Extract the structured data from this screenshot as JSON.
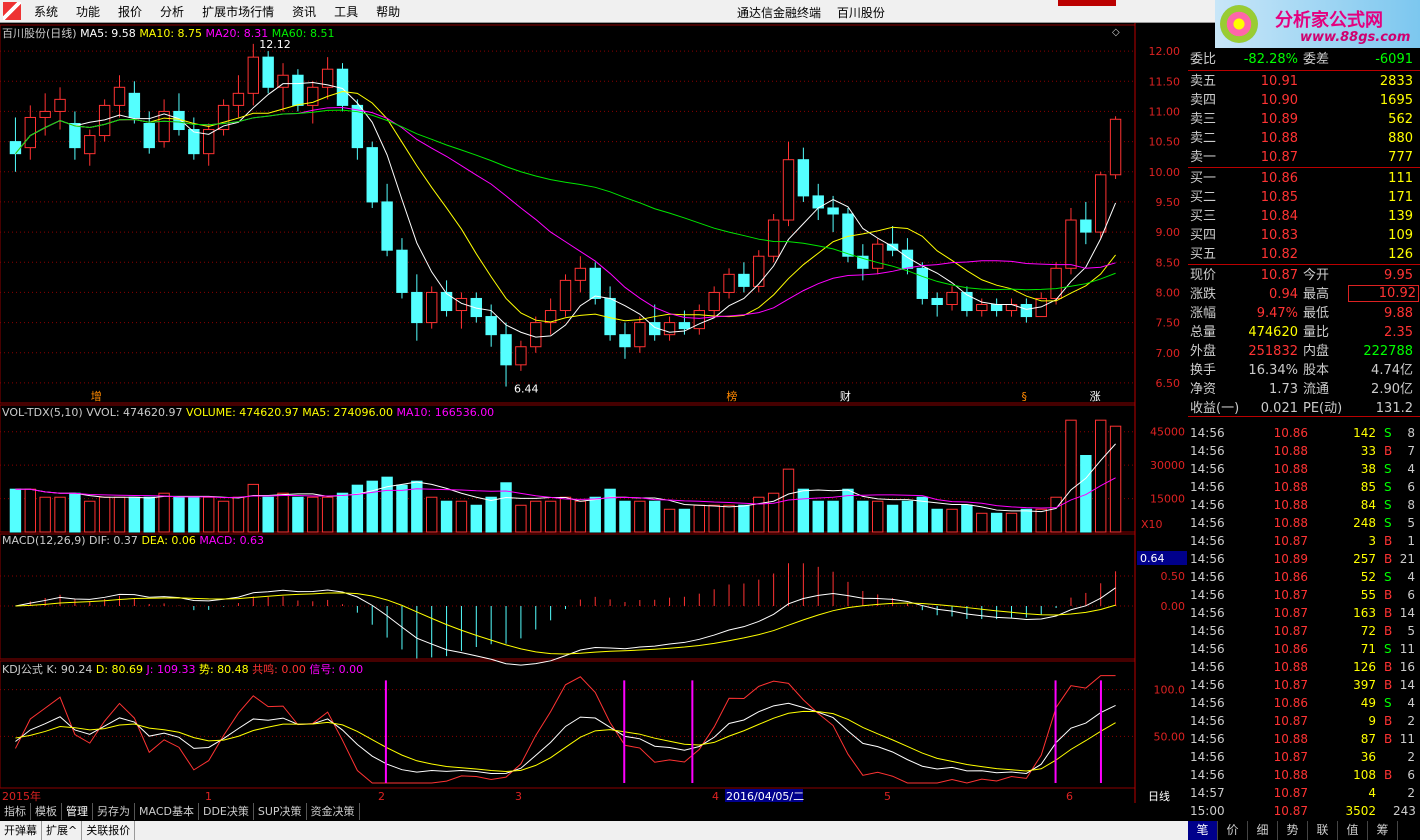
{
  "menu": {
    "items": [
      "系统",
      "功能",
      "报价",
      "分析",
      "扩展市场行情",
      "资讯",
      "工具",
      "帮助"
    ],
    "center_items": [
      "通达信金融终端",
      "百川股份"
    ]
  },
  "brand": {
    "title": "分析家公式网",
    "url": "www.88gs.com"
  },
  "colors": {
    "up": "#ff3232",
    "down": "#54ffff",
    "ma5": "#ffffff",
    "ma10": "#ffff00",
    "ma20": "#ff00ff",
    "ma60": "#00e600",
    "grid": "#8b0000",
    "bg": "#000000"
  },
  "main_chart": {
    "title": "百川股份(日线)",
    "ma5": "MA5: 9.58",
    "ma10": "MA10: 8.75",
    "ma20": "MA20: 8.31",
    "ma60": "MA60: 8.51",
    "high_label": "12.12",
    "low_label": "6.44",
    "markers": [
      "增",
      "榜",
      "财",
      "§",
      "涨"
    ],
    "y_ticks": [
      "12.00",
      "11.50",
      "11.00",
      "10.50",
      "10.00",
      "9.50",
      "9.00",
      "8.50",
      "8.00",
      "7.50",
      "7.00",
      "6.50"
    ]
  },
  "vol_chart": {
    "title": "VOL-TDX(5,10)",
    "vvol": "VVOL: 474620.97",
    "volume": "VOLUME: 474620.97",
    "ma5": "MA5: 274096.00",
    "ma10": "MA10: 166536.00",
    "y_ticks": [
      "45000",
      "30000",
      "15000"
    ],
    "unit": "X10"
  },
  "macd_chart": {
    "title": "MACD(12,26,9)",
    "dif": "DIF: 0.37",
    "dea": "DEA: 0.06",
    "macd": "MACD: 0.63",
    "y_ticks": [
      "0.50",
      "0.00"
    ],
    "current": "0.64"
  },
  "kdj_chart": {
    "title": "KDJ公式",
    "k": "K: 90.24",
    "d": "D: 80.69",
    "j": "J: 109.33",
    "shi": "势: 80.48",
    "gongming": "共鸣: 0.00",
    "xinhao": "信号: 0.00",
    "y_ticks": [
      "100.0",
      "50.00"
    ]
  },
  "xaxis": {
    "labels": [
      "2015年",
      "1",
      "2",
      "3",
      "4",
      "2016/04/05/二",
      "5",
      "6"
    ],
    "period": "日线"
  },
  "bottom_tabs": [
    "指标",
    "模板",
    "管理",
    "另存为",
    "MACD基本",
    "DDE决策",
    "SUP决策",
    "资金决策"
  ],
  "status_items": [
    "开弹幕",
    "扩展^",
    "关联报价"
  ],
  "quote": {
    "weibi_label": "委比",
    "weibi_value": "-82.28%",
    "weicha_label": "委差",
    "weicha_value": "-6091",
    "asks": [
      {
        "label": "卖五",
        "price": "10.91",
        "vol": "2833"
      },
      {
        "label": "卖四",
        "price": "10.90",
        "vol": "1695"
      },
      {
        "label": "卖三",
        "price": "10.89",
        "vol": "562"
      },
      {
        "label": "卖二",
        "price": "10.88",
        "vol": "880"
      },
      {
        "label": "卖一",
        "price": "10.87",
        "vol": "777"
      }
    ],
    "bids": [
      {
        "label": "买一",
        "price": "10.86",
        "vol": "111"
      },
      {
        "label": "买二",
        "price": "10.85",
        "vol": "171"
      },
      {
        "label": "买三",
        "price": "10.84",
        "vol": "139"
      },
      {
        "label": "买四",
        "price": "10.83",
        "vol": "109"
      },
      {
        "label": "买五",
        "price": "10.82",
        "vol": "126"
      }
    ],
    "stats": [
      {
        "l1": "现价",
        "v1": "10.87",
        "l2": "今开",
        "v2": "9.95"
      },
      {
        "l1": "涨跌",
        "v1": "0.94",
        "l2": "最高",
        "v2": "10.92"
      },
      {
        "l1": "涨幅",
        "v1": "9.47%",
        "l2": "最低",
        "v2": "9.88"
      },
      {
        "l1": "总量",
        "v1": "474620",
        "l2": "量比",
        "v2": "2.35"
      },
      {
        "l1": "外盘",
        "v1": "251832",
        "l2": "内盘",
        "v2": "222788"
      },
      {
        "l1": "换手",
        "v1": "16.34%",
        "l2": "股本",
        "v2": "4.74亿"
      },
      {
        "l1": "净资",
        "v1": "1.73",
        "l2": "流通",
        "v2": "2.90亿"
      },
      {
        "l1": "收益(一)",
        "v1": "0.021",
        "l2": "PE(动)",
        "v2": "131.2"
      }
    ],
    "ticks": [
      {
        "t": "14:56",
        "p": "10.86",
        "v": "142",
        "bs": "S",
        "n": "8"
      },
      {
        "t": "14:56",
        "p": "10.88",
        "v": "33",
        "bs": "B",
        "n": "7"
      },
      {
        "t": "14:56",
        "p": "10.88",
        "v": "38",
        "bs": "S",
        "n": "4"
      },
      {
        "t": "14:56",
        "p": "10.88",
        "v": "85",
        "bs": "S",
        "n": "6"
      },
      {
        "t": "14:56",
        "p": "10.88",
        "v": "84",
        "bs": "S",
        "n": "8"
      },
      {
        "t": "14:56",
        "p": "10.88",
        "v": "248",
        "bs": "S",
        "n": "5"
      },
      {
        "t": "14:56",
        "p": "10.87",
        "v": "3",
        "bs": "B",
        "n": "1"
      },
      {
        "t": "14:56",
        "p": "10.89",
        "v": "257",
        "bs": "B",
        "n": "21"
      },
      {
        "t": "14:56",
        "p": "10.86",
        "v": "52",
        "bs": "S",
        "n": "4"
      },
      {
        "t": "14:56",
        "p": "10.87",
        "v": "55",
        "bs": "B",
        "n": "6"
      },
      {
        "t": "14:56",
        "p": "10.87",
        "v": "163",
        "bs": "B",
        "n": "14"
      },
      {
        "t": "14:56",
        "p": "10.87",
        "v": "72",
        "bs": "B",
        "n": "5"
      },
      {
        "t": "14:56",
        "p": "10.86",
        "v": "71",
        "bs": "S",
        "n": "11"
      },
      {
        "t": "14:56",
        "p": "10.88",
        "v": "126",
        "bs": "B",
        "n": "16"
      },
      {
        "t": "14:56",
        "p": "10.87",
        "v": "397",
        "bs": "B",
        "n": "14"
      },
      {
        "t": "14:56",
        "p": "10.86",
        "v": "49",
        "bs": "S",
        "n": "4"
      },
      {
        "t": "14:56",
        "p": "10.87",
        "v": "9",
        "bs": "B",
        "n": "2"
      },
      {
        "t": "14:56",
        "p": "10.88",
        "v": "87",
        "bs": "B",
        "n": "11"
      },
      {
        "t": "14:56",
        "p": "10.87",
        "v": "36",
        "bs": "",
        "n": "2"
      },
      {
        "t": "14:56",
        "p": "10.88",
        "v": "108",
        "bs": "B",
        "n": "6"
      },
      {
        "t": "14:57",
        "p": "10.87",
        "v": "4",
        "bs": "",
        "n": "2"
      },
      {
        "t": "15:00",
        "p": "10.87",
        "v": "3502",
        "bs": "",
        "n": "243"
      }
    ],
    "bottom_tabs": [
      "笔",
      "价",
      "细",
      "势",
      "联",
      "值",
      "筹"
    ]
  },
  "chart_data": {
    "type": "candlestick",
    "title": "百川股份(日线)",
    "ylim": [
      6.3,
      12.3
    ],
    "ohlc": [
      [
        10.5,
        10.9,
        10.0,
        10.3
      ],
      [
        10.4,
        11.1,
        10.2,
        10.9
      ],
      [
        10.9,
        11.3,
        10.6,
        11.0
      ],
      [
        11.0,
        11.4,
        10.7,
        11.2
      ],
      [
        10.8,
        11.0,
        10.2,
        10.4
      ],
      [
        10.3,
        10.7,
        10.1,
        10.6
      ],
      [
        10.6,
        11.2,
        10.5,
        11.1
      ],
      [
        11.1,
        11.6,
        10.9,
        11.4
      ],
      [
        11.3,
        11.5,
        10.8,
        10.9
      ],
      [
        10.8,
        11.0,
        10.3,
        10.4
      ],
      [
        10.5,
        11.2,
        10.4,
        11.0
      ],
      [
        11.0,
        11.3,
        10.6,
        10.7
      ],
      [
        10.7,
        10.9,
        10.2,
        10.3
      ],
      [
        10.3,
        10.8,
        10.1,
        10.7
      ],
      [
        10.7,
        11.2,
        10.6,
        11.1
      ],
      [
        11.1,
        11.6,
        10.9,
        11.3
      ],
      [
        11.3,
        12.12,
        11.1,
        11.9
      ],
      [
        11.9,
        12.0,
        11.3,
        11.4
      ],
      [
        11.4,
        11.8,
        11.0,
        11.6
      ],
      [
        11.6,
        11.7,
        11.0,
        11.1
      ],
      [
        11.1,
        11.5,
        10.8,
        11.4
      ],
      [
        11.4,
        11.9,
        11.2,
        11.7
      ],
      [
        11.7,
        11.8,
        11.0,
        11.1
      ],
      [
        11.1,
        11.2,
        10.2,
        10.4
      ],
      [
        10.4,
        10.5,
        9.4,
        9.5
      ],
      [
        9.5,
        9.8,
        8.6,
        8.7
      ],
      [
        8.7,
        8.9,
        7.9,
        8.0
      ],
      [
        8.0,
        8.3,
        7.2,
        7.5
      ],
      [
        7.5,
        8.1,
        7.4,
        8.0
      ],
      [
        8.0,
        8.2,
        7.6,
        7.7
      ],
      [
        7.7,
        8.0,
        7.4,
        7.9
      ],
      [
        7.9,
        8.0,
        7.5,
        7.6
      ],
      [
        7.6,
        7.8,
        7.1,
        7.3
      ],
      [
        7.3,
        7.5,
        6.44,
        6.8
      ],
      [
        6.8,
        7.2,
        6.7,
        7.1
      ],
      [
        7.1,
        7.6,
        7.0,
        7.5
      ],
      [
        7.5,
        7.9,
        7.3,
        7.7
      ],
      [
        7.7,
        8.3,
        7.6,
        8.2
      ],
      [
        8.2,
        8.6,
        8.0,
        8.4
      ],
      [
        8.4,
        8.5,
        7.8,
        7.9
      ],
      [
        7.9,
        8.1,
        7.2,
        7.3
      ],
      [
        7.3,
        7.5,
        6.9,
        7.1
      ],
      [
        7.1,
        7.6,
        7.0,
        7.5
      ],
      [
        7.5,
        7.8,
        7.2,
        7.3
      ],
      [
        7.3,
        7.6,
        7.2,
        7.5
      ],
      [
        7.5,
        7.7,
        7.3,
        7.4
      ],
      [
        7.4,
        7.8,
        7.3,
        7.7
      ],
      [
        7.7,
        8.1,
        7.6,
        8.0
      ],
      [
        8.0,
        8.4,
        7.9,
        8.3
      ],
      [
        8.3,
        8.5,
        8.0,
        8.1
      ],
      [
        8.1,
        8.7,
        8.0,
        8.6
      ],
      [
        8.6,
        9.3,
        8.5,
        9.2
      ],
      [
        9.2,
        10.5,
        9.1,
        10.2
      ],
      [
        10.2,
        10.4,
        9.5,
        9.6
      ],
      [
        9.6,
        9.8,
        9.2,
        9.4
      ],
      [
        9.4,
        9.6,
        9.0,
        9.3
      ],
      [
        9.3,
        9.4,
        8.5,
        8.6
      ],
      [
        8.6,
        8.8,
        8.2,
        8.4
      ],
      [
        8.4,
        8.9,
        8.3,
        8.8
      ],
      [
        8.8,
        9.1,
        8.6,
        8.7
      ],
      [
        8.7,
        8.9,
        8.3,
        8.4
      ],
      [
        8.4,
        8.5,
        7.8,
        7.9
      ],
      [
        7.9,
        8.0,
        7.6,
        7.8
      ],
      [
        7.8,
        8.1,
        7.7,
        8.0
      ],
      [
        8.0,
        8.1,
        7.6,
        7.7
      ],
      [
        7.7,
        7.9,
        7.6,
        7.8
      ],
      [
        7.8,
        7.9,
        7.6,
        7.7
      ],
      [
        7.7,
        7.9,
        7.6,
        7.8
      ],
      [
        7.8,
        7.9,
        7.5,
        7.6
      ],
      [
        7.6,
        8.0,
        7.6,
        7.9
      ],
      [
        7.9,
        8.5,
        7.8,
        8.4
      ],
      [
        8.4,
        9.4,
        8.3,
        9.2
      ],
      [
        9.2,
        9.5,
        8.8,
        9.0
      ],
      [
        9.0,
        10.0,
        8.9,
        9.95
      ],
      [
        9.95,
        10.92,
        9.88,
        10.87
      ]
    ]
  }
}
